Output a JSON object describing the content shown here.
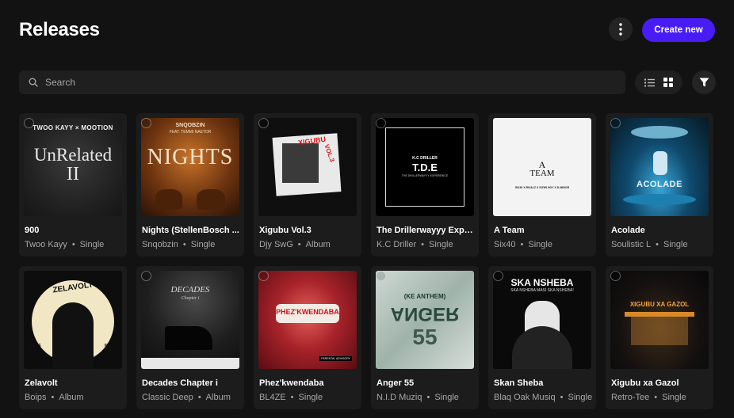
{
  "header": {
    "title": "Releases",
    "more_icon": "more-vertical-icon",
    "create_label": "Create new",
    "accent": "#4a1cf5"
  },
  "search": {
    "placeholder": "Search",
    "value": ""
  },
  "toolbar": {
    "list_icon": "list-view-icon",
    "grid_icon": "grid-view-icon",
    "filter_icon": "filter-icon"
  },
  "releases": [
    {
      "title": "900",
      "artist": "Twoo Kayy",
      "type": "Single",
      "art": {
        "line1": "TWOO KAYY × MOOTION",
        "line2": "UnRelated",
        "line3": "II"
      }
    },
    {
      "title": "Nights (StellenBosch ...",
      "artist": "Snqobzin",
      "type": "Single",
      "art": {
        "line1": "SNQOBZIN",
        "line2": "FEAT. TEMMI NAETOR",
        "line3": "NIGHTS"
      }
    },
    {
      "title": "Xigubu Vol.3",
      "artist": "Djy SwG",
      "type": "Album",
      "art": {
        "line1": "XIGUBU",
        "line2": "VOL.3"
      }
    },
    {
      "title": "The Drillerwayyy Exper...",
      "artist": "K.C Driller",
      "type": "Single",
      "art": {
        "line1": "K.C DRILLER",
        "line2": "T.D.E",
        "line3": "THE DRILLERWAYYY EXPERIENCE"
      }
    },
    {
      "title": "A Team",
      "artist": "Six40",
      "type": "Single",
      "art": {
        "line1": "A",
        "line2": "TEAM",
        "line3": "SIX40 X RIVALZ X SIZWI NOY X D-MINOR"
      }
    },
    {
      "title": "Acolade",
      "artist": "Soulistic L",
      "type": "Single",
      "art": {
        "line1": "ACOLADE"
      }
    },
    {
      "title": "Zelavolt",
      "artist": "Boips",
      "type": "Album",
      "art": {
        "line1": "ZELAVOLT",
        "line2": "BOIPS",
        "line3": "MUSIC"
      }
    },
    {
      "title": "Decades Chapter i",
      "artist": "Classic Deep",
      "type": "Album",
      "art": {
        "line1": "DECADES",
        "line2": "Chapter i"
      }
    },
    {
      "title": "Phez'kwendaba",
      "artist": "BL4ZE",
      "type": "Single",
      "art": {
        "line1": "PHEZ'KWENDABA",
        "line2": "PARENTAL ADVISORY"
      }
    },
    {
      "title": "Anger 55",
      "artist": "N.I.D Muziq",
      "type": "Single",
      "art": {
        "line1": "(KE ANTHEM)",
        "line2": "ANGER",
        "line3": "55"
      }
    },
    {
      "title": "Skan Sheba",
      "artist": "Blaq Oak Musiq",
      "type": "Single",
      "art": {
        "line1": "SKA NSHEBA",
        "line2": "SKA NSHEBA MASI SKA NSHEBA!"
      }
    },
    {
      "title": "Xigubu xa Gazol",
      "artist": "Retro-Tee",
      "type": "Single",
      "art": {
        "line1": "XIGUBU XA GAZOL"
      }
    }
  ]
}
